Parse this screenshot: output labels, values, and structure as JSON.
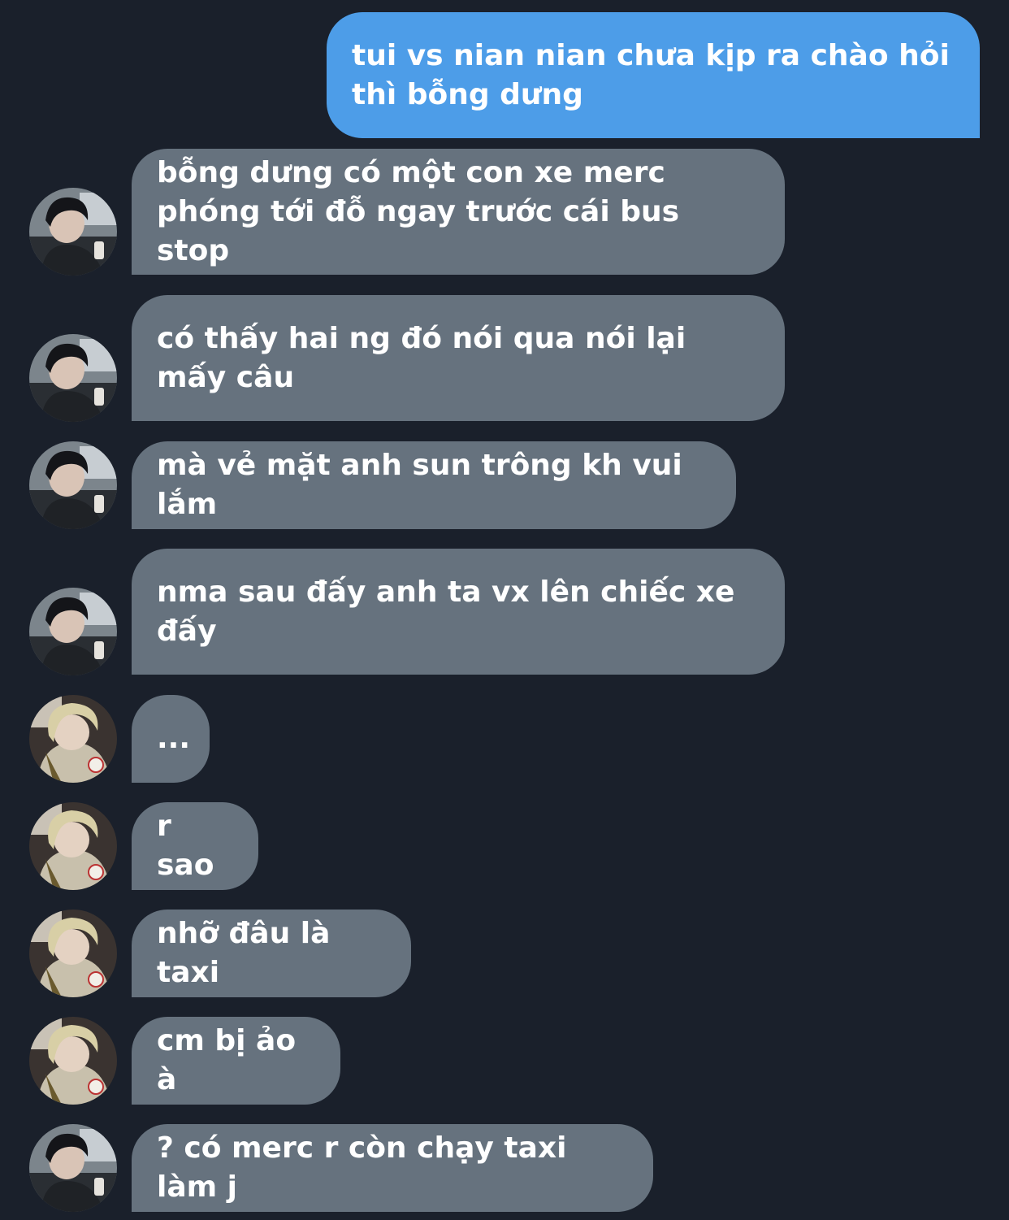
{
  "chat": {
    "sent_message": "tui vs nian nian chưa kịp ra chào hỏi thì bỗng dưng",
    "received_messages": [
      {
        "text": "bỗng dưng có một con xe merc phóng tới đỗ ngay trước cái bus stop",
        "avatar": "avatar-dark-hair"
      },
      {
        "text": "có thấy hai ng đó nói qua nói lại mấy câu",
        "avatar": "avatar-dark-hair"
      },
      {
        "text": "mà vẻ mặt anh sun trông kh vui lắm",
        "avatar": "avatar-dark-hair"
      },
      {
        "text": "nma sau đấy anh ta vx lên chiếc xe đấy",
        "avatar": "avatar-dark-hair"
      },
      {
        "text": "...",
        "avatar": "avatar-blonde-hair"
      },
      {
        "text": "r sao",
        "avatar": "avatar-blonde-hair"
      },
      {
        "text": "nhỡ đâu là taxi",
        "avatar": "avatar-blonde-hair"
      },
      {
        "text": "cm bị ảo à",
        "avatar": "avatar-blonde-hair"
      },
      {
        "text": "? có merc r còn chạy taxi làm j",
        "avatar": "avatar-dark-hair"
      }
    ]
  },
  "colors": {
    "background": "#1a202b",
    "sent_bubble": "#4d9de8",
    "received_bubble": "#66727e",
    "text": "#ffffff"
  }
}
